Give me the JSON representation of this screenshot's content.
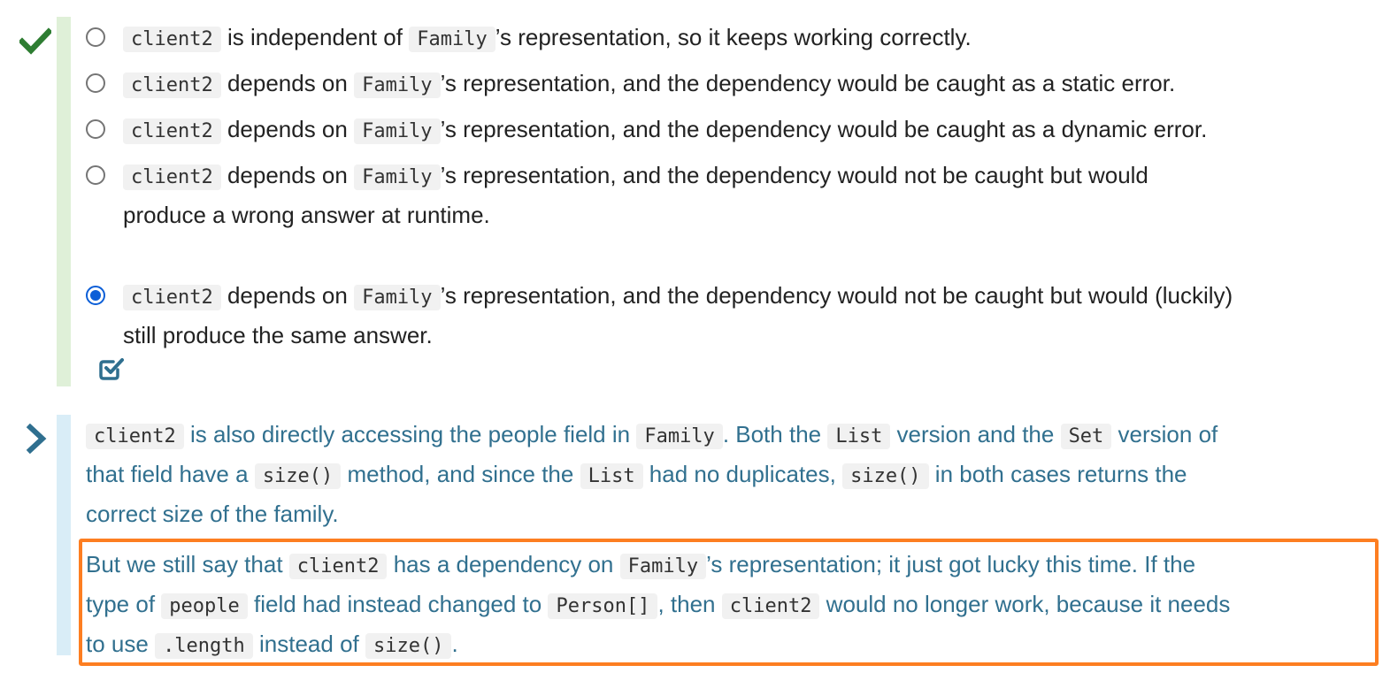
{
  "question": {
    "correct_icon": "check-icon",
    "options": [
      {
        "selected": false,
        "lines": [
          [
            {
              "c": "client2"
            },
            {
              "t": " is independent of "
            },
            {
              "c": "Family"
            },
            {
              "t": "’s representation, so it keeps working correctly."
            }
          ]
        ]
      },
      {
        "selected": false,
        "lines": [
          [
            {
              "c": "client2"
            },
            {
              "t": " depends on "
            },
            {
              "c": "Family"
            },
            {
              "t": "’s representation, and the dependency would be caught as a static error."
            }
          ]
        ]
      },
      {
        "selected": false,
        "lines": [
          [
            {
              "c": "client2"
            },
            {
              "t": " depends on "
            },
            {
              "c": "Family"
            },
            {
              "t": "’s representation, and the dependency would be caught as a dynamic error."
            }
          ]
        ]
      },
      {
        "selected": false,
        "lines": [
          [
            {
              "c": "client2"
            },
            {
              "t": " depends on "
            },
            {
              "c": "Family"
            },
            {
              "t": "’s representation, and the dependency would not be caught but would"
            }
          ],
          [
            {
              "t": "produce a wrong answer at runtime."
            }
          ]
        ]
      },
      {
        "selected": true,
        "lines": [
          [
            {
              "c": "client2"
            },
            {
              "t": " depends on "
            },
            {
              "c": "Family"
            },
            {
              "t": "’s representation, and the dependency would not be caught but would (luckily)"
            }
          ],
          [
            {
              "t": "still produce the same answer."
            }
          ]
        ]
      }
    ],
    "selected_icon": "checkbox-checked-icon"
  },
  "feedback": {
    "icon": "chevron-right-icon",
    "paragraphs": [
      {
        "lines": [
          [
            {
              "c": "client2"
            },
            {
              "t": " is also directly accessing the people field in "
            },
            {
              "c": "Family"
            },
            {
              "t": ". Both the "
            },
            {
              "c": "List"
            },
            {
              "t": " version and the "
            },
            {
              "c": "Set"
            },
            {
              "t": " version of"
            }
          ],
          [
            {
              "t": "that field have a "
            },
            {
              "c": "size()"
            },
            {
              "t": " method, and since the "
            },
            {
              "c": "List"
            },
            {
              "t": " had no duplicates, "
            },
            {
              "c": "size()"
            },
            {
              "t": " in both cases returns the"
            }
          ],
          [
            {
              "t": "correct size of the family."
            }
          ]
        ]
      },
      {
        "highlighted": true,
        "lines": [
          [
            {
              "t": "But we still say that "
            },
            {
              "c": "client2"
            },
            {
              "t": " has a dependency on "
            },
            {
              "c": "Family"
            },
            {
              "t": "’s representation; it just got lucky this time. If the"
            }
          ],
          [
            {
              "t": "type of "
            },
            {
              "c": "people"
            },
            {
              "t": " field had instead changed to "
            },
            {
              "c": "Person[]"
            },
            {
              "t": ", then "
            },
            {
              "c": "client2"
            },
            {
              "t": " would no longer work, because it needs"
            }
          ],
          [
            {
              "t": "to use "
            },
            {
              "c": ".length"
            },
            {
              "t": " instead of "
            },
            {
              "c": "size()"
            },
            {
              "t": "."
            }
          ]
        ]
      }
    ]
  },
  "colors": {
    "correct_green": "#2e7d32",
    "correct_bar": "#dff0d8",
    "radio_selected": "#0b5ed7",
    "feedback_text": "#31708f",
    "feedback_bar": "#d9edf7",
    "highlight_border": "#fd7e21",
    "icon_teal": "#2f6f8f"
  }
}
